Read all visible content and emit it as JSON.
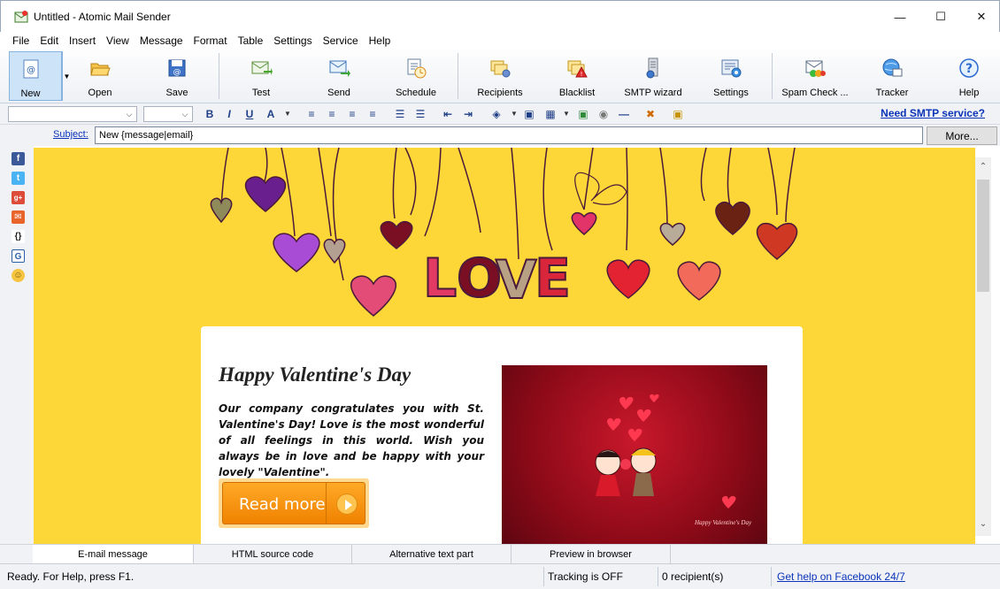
{
  "window": {
    "title": "Untitled - Atomic Mail Sender"
  },
  "menu": [
    "File",
    "Edit",
    "Insert",
    "View",
    "Message",
    "Format",
    "Table",
    "Settings",
    "Service",
    "Help"
  ],
  "toolbar": {
    "new": "New",
    "open": "Open",
    "save": "Save",
    "test": "Test",
    "send": "Send",
    "schedule": "Schedule",
    "recipients": "Recipients",
    "blacklist": "Blacklist",
    "smtp_wizard": "SMTP wizard",
    "settings": "Settings",
    "spam_check": "Spam Check ...",
    "tracker": "Tracker",
    "help": "Help"
  },
  "formatbar": {
    "smtp_link": "Need SMTP service?"
  },
  "subject": {
    "label": "Subject:",
    "value": "New {message|email}",
    "more": "More..."
  },
  "email": {
    "title": "Happy Valentine's Day",
    "body": "Our company congratulates you with St. Valentine's Day! Love is the most wonderful of all feelings in this world. Wish you always be in love and be happy with your lovely \"Valentine\".",
    "button": "Read more",
    "banner_word": "LOVE",
    "photo_caption": "Happy Valentine's Day"
  },
  "tabs": [
    "E-mail message",
    "HTML source code",
    "Alternative text part",
    "Preview in browser"
  ],
  "status": {
    "ready": "Ready. For Help, press F1.",
    "tracking": "Tracking is OFF",
    "recipients": "0 recipient(s)",
    "facebook": "Get help on Facebook 24/7"
  },
  "colors": {
    "banner_bg": "#fdd637",
    "accent_link": "#0a33b8",
    "button_orange": "#f59000"
  }
}
